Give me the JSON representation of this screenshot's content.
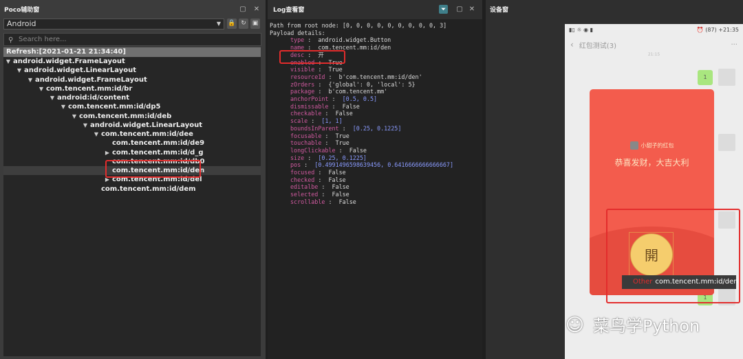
{
  "poco": {
    "title": "Poco辅助窗",
    "device_select": "Android",
    "search_placeholder": "Search here...",
    "refresh": "Refresh:[2021-01-21 21:34:40]",
    "tree": [
      {
        "label": "android.widget.FrameLayout",
        "arrow": "▼"
      },
      {
        "label": "android.widget.LinearLayout",
        "arrow": "▼"
      },
      {
        "label": "android.widget.FrameLayout",
        "arrow": "▼"
      },
      {
        "label": "com.tencent.mm:id/br",
        "arrow": "▼"
      },
      {
        "label": "android:id/content",
        "arrow": "▼"
      },
      {
        "label": "com.tencent.mm:id/dp5",
        "arrow": "▼"
      },
      {
        "label": "com.tencent.mm:id/deb",
        "arrow": "▼"
      },
      {
        "label": "android.widget.LinearLayout",
        "arrow": "▼"
      },
      {
        "label": "com.tencent.mm:id/dee",
        "arrow": "▼"
      },
      {
        "label": "com.tencent.mm:id/de9",
        "arrow": ""
      },
      {
        "label": "com.tencent.mm:id/d_g",
        "arrow": "▶"
      },
      {
        "label": "com.tencent.mm:id/db0",
        "arrow": ""
      },
      {
        "label": "com.tencent.mm:id/den",
        "arrow": ""
      },
      {
        "label": "com.tencent.mm:id/del",
        "arrow": "▶"
      },
      {
        "label": "com.tencent.mm:id/dem",
        "arrow": ""
      }
    ]
  },
  "log": {
    "title": "Log查看窗",
    "path_line": "Path from root node: [0, 0, 0, 0, 0, 0, 0, 0, 0, 3]",
    "payload_line": "Payload details:",
    "rows": [
      {
        "k": "type",
        "v": "android.widget.Button",
        "c": "s"
      },
      {
        "k": "name",
        "v": "com.tencent.mm:id/den",
        "c": "s"
      },
      {
        "k": "desc",
        "v": "开",
        "c": "s"
      },
      {
        "k": "enabled",
        "v": "True",
        "c": "s"
      },
      {
        "k": "visible",
        "v": "True",
        "c": "s"
      },
      {
        "k": "resourceId",
        "v": "b'com.tencent.mm:id/den'",
        "c": "s"
      },
      {
        "k": "zOrders",
        "v": "{'global': 0, 'local': 5}",
        "c": "s"
      },
      {
        "k": "package",
        "v": "b'com.tencent.mm'",
        "c": "s"
      },
      {
        "k": "anchorPoint",
        "v": "[0.5, 0.5]",
        "c": "n"
      },
      {
        "k": "dismissable",
        "v": "False",
        "c": "s"
      },
      {
        "k": "checkable",
        "v": "False",
        "c": "s"
      },
      {
        "k": "scale",
        "v": "[1, 1]",
        "c": "n"
      },
      {
        "k": "boundsInParent",
        "v": "[0.25, 0.1225]",
        "c": "n"
      },
      {
        "k": "focusable",
        "v": "True",
        "c": "s"
      },
      {
        "k": "touchable",
        "v": "True",
        "c": "s"
      },
      {
        "k": "longClickable",
        "v": "False",
        "c": "s"
      },
      {
        "k": "size",
        "v": "[0.25, 0.1225]",
        "c": "n"
      },
      {
        "k": "pos",
        "v": "[0.4991496598639456, 0.6416666666666667]",
        "c": "n"
      },
      {
        "k": "focused",
        "v": "False",
        "c": "s"
      },
      {
        "k": "checked",
        "v": "False",
        "c": "s"
      },
      {
        "k": "editalbe",
        "v": "False",
        "c": "s"
      },
      {
        "k": "selected",
        "v": "False",
        "c": "s"
      },
      {
        "k": "scrollable",
        "v": "False",
        "c": "s"
      }
    ]
  },
  "device": {
    "title": "设备窗",
    "status_left": "▮▯ ☼ ◉ ▮",
    "status_right": "⏰ (87) +21:35",
    "chat_title": "红包测试(3)",
    "timestamp": "21:15",
    "sender": "小甜子的红包",
    "greeting": "恭喜发财，大吉大利",
    "open_button": "開",
    "tooltip_type": "Other",
    "tooltip_name": "com.tencent.mm:id/den",
    "watermark": "菜鸟学Python",
    "green_bubble_1": "1",
    "green_bubble_2": "1"
  }
}
